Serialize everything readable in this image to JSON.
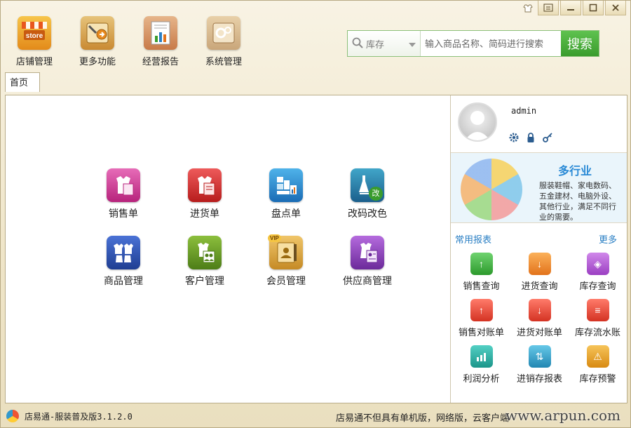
{
  "window": {
    "controls": [
      "skin",
      "menu",
      "minimize",
      "maximize",
      "close"
    ]
  },
  "toolbar": {
    "items": [
      {
        "label": "店铺管理",
        "icon": "store-icon",
        "icon_text": "store"
      },
      {
        "label": "更多功能",
        "icon": "more-functions-icon"
      },
      {
        "label": "经营报告",
        "icon": "report-chart-icon"
      },
      {
        "label": "系统管理",
        "icon": "system-settings-icon"
      }
    ]
  },
  "search": {
    "scope": "库存",
    "placeholder": "输入商品名称、简码进行搜索",
    "button": "搜索"
  },
  "tabs": [
    {
      "label": "首页"
    }
  ],
  "modules": [
    {
      "label": "销售单",
      "icon": "sales-order-icon"
    },
    {
      "label": "进货单",
      "icon": "purchase-order-icon"
    },
    {
      "label": "盘点单",
      "icon": "inventory-count-icon"
    },
    {
      "label": "改码改色",
      "icon": "change-code-color-icon",
      "badge": "改"
    },
    {
      "label": "商品管理",
      "icon": "product-management-icon"
    },
    {
      "label": "客户管理",
      "icon": "customer-management-icon"
    },
    {
      "label": "会员管理",
      "icon": "member-management-icon",
      "badge": "VIP"
    },
    {
      "label": "供应商管理",
      "icon": "supplier-management-icon"
    }
  ],
  "user": {
    "name": "admin"
  },
  "promo": {
    "title": "多行业",
    "text": "服装鞋帽、家电数码、五金建材、电脑外设、其他行业，满足不同行业的需要。"
  },
  "reports": {
    "title": "常用报表",
    "more": "更多",
    "items": [
      {
        "label": "销售查询",
        "icon": "sales-query-icon"
      },
      {
        "label": "进货查询",
        "icon": "purchase-query-icon"
      },
      {
        "label": "库存查询",
        "icon": "stock-query-icon"
      },
      {
        "label": "销售对账单",
        "icon": "sales-statement-icon"
      },
      {
        "label": "进货对账单",
        "icon": "purchase-statement-icon"
      },
      {
        "label": "库存流水账",
        "icon": "stock-ledger-icon"
      },
      {
        "label": "利润分析",
        "icon": "profit-analysis-icon"
      },
      {
        "label": "进销存报表",
        "icon": "inventory-report-icon"
      },
      {
        "label": "库存预警",
        "icon": "stock-alert-icon"
      }
    ]
  },
  "status": {
    "version": "店易通-服装普及版3.1.2.0",
    "marquee": "店易通不但具有单机版，网络版，云客户端",
    "watermark": "www.arpun.com"
  }
}
